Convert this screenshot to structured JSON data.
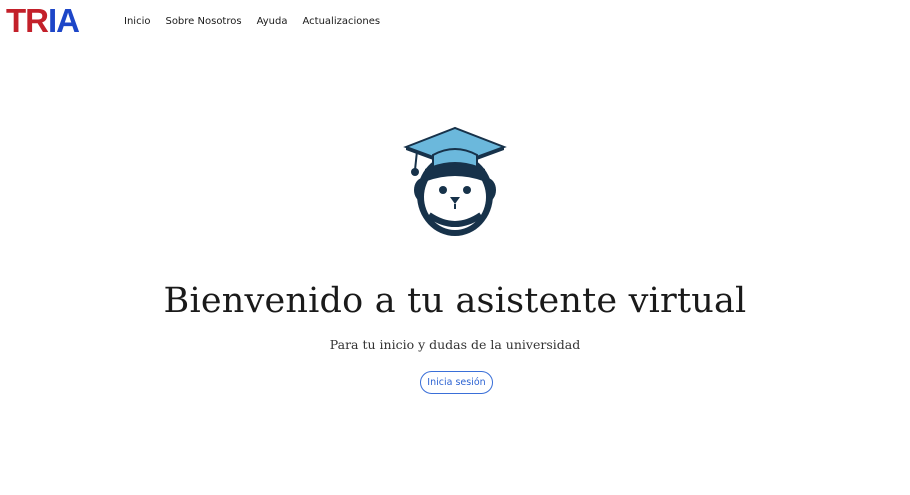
{
  "header": {
    "logo": {
      "part1": "TR",
      "part2": "IA"
    },
    "nav": [
      {
        "label": "Inicio"
      },
      {
        "label": "Sobre Nosotros"
      },
      {
        "label": "Ayuda"
      },
      {
        "label": "Actualizaciones"
      }
    ]
  },
  "hero": {
    "mascot_icon": "graduation-cap-robot-icon",
    "title": "Bienvenido a tu asistente virtual",
    "subtitle": "Para tu inicio y dudas de la universidad",
    "login_label": "Inicia sesión"
  },
  "colors": {
    "logo_red": "#c3202a",
    "logo_blue": "#1d46c8",
    "accent": "#2d63d2",
    "mascot_dark": "#17324a",
    "mascot_cap": "#6bb8dc",
    "mascot_ear": "#d9534f"
  }
}
